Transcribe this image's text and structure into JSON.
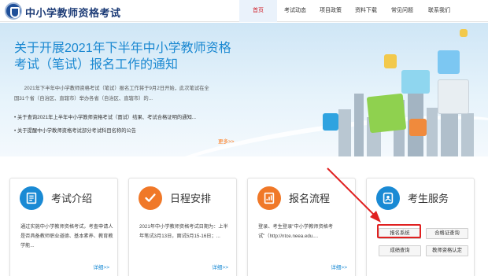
{
  "header": {
    "site_title": "中小学教师资格考试",
    "nav": [
      {
        "label": "首页",
        "active": true
      },
      {
        "label": "考试动态",
        "active": false
      },
      {
        "label": "项目政策",
        "active": false
      },
      {
        "label": "资料下载",
        "active": false
      },
      {
        "label": "常见问题",
        "active": false
      },
      {
        "label": "联系我们",
        "active": false
      }
    ]
  },
  "banner": {
    "title": "关于开展2021年下半年中小学教师资格考试（笔试）报名工作的通知",
    "description": "2021年下半年中小学教师资格考试（笔试）报名工作将于9月2日开始，此次笔试在全国31个省（自治区、直辖市）举办各省（自治区、直辖市）的...",
    "list": [
      "关于查询2021年上半年中小学教师资格考试（面试）结果、考试合格证明的通知...",
      "关于提醒中小学教师资格考试部分考试科目名称的公告"
    ],
    "more": "更多>>"
  },
  "cards": [
    {
      "title": "考试介绍",
      "text": "通过实施中小学教师资格考试，考查申请人是否具备教师职业道德、基本素养、教育教学能...",
      "more": "详细>>",
      "icon": "notebook-icon",
      "icon_color": "#1a8ad4"
    },
    {
      "title": "日程安排",
      "text": "2021年中小学教师资格考试日期为：上半年笔试3月13日，面试5月15-16日；...",
      "more": "详细>>",
      "icon": "checkmark-icon",
      "icon_color": "#f07828"
    },
    {
      "title": "报名流程",
      "text": "登录、考生登录\"中小学教师资格考试\"（http://ntce.neea.edu....",
      "more": "详细>>",
      "icon": "report-icon",
      "icon_color": "#f07828"
    },
    {
      "title": "考生服务",
      "icon": "user-card-icon",
      "icon_color": "#1a8ad4",
      "buttons": [
        "报名系统",
        "合格证查询",
        "成绩查询",
        "教师资格认定"
      ]
    }
  ],
  "colors": {
    "highlight": "#e02020",
    "accent_blue": "#1a88d1",
    "accent_orange": "#ff7a1a"
  }
}
